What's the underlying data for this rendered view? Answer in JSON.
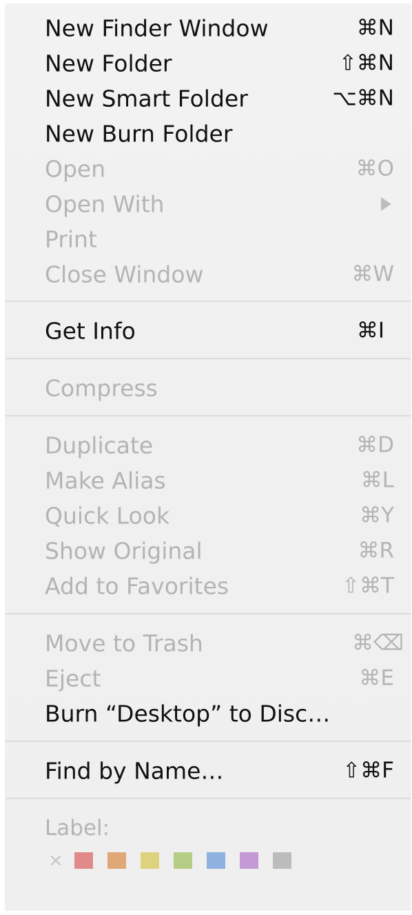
{
  "menu": {
    "items": [
      {
        "label": "New Finder Window",
        "shortcut": "⌘N"
      },
      {
        "label": "New Folder",
        "shortcut": "⇧⌘N"
      },
      {
        "label": "New Smart Folder",
        "shortcut": "⌥⌘N"
      },
      {
        "label": "New Burn Folder",
        "shortcut": ""
      },
      {
        "label": "Open",
        "shortcut": "⌘O"
      },
      {
        "label": "Open With",
        "shortcut": ""
      },
      {
        "label": "Print",
        "shortcut": ""
      },
      {
        "label": "Close Window",
        "shortcut": "⌘W"
      },
      {
        "label": "Get Info",
        "shortcut": "⌘I"
      },
      {
        "label": "Compress",
        "shortcut": ""
      },
      {
        "label": "Duplicate",
        "shortcut": "⌘D"
      },
      {
        "label": "Make Alias",
        "shortcut": "⌘L"
      },
      {
        "label": "Quick Look",
        "shortcut": "⌘Y"
      },
      {
        "label": "Show Original",
        "shortcut": "⌘R"
      },
      {
        "label": "Add to Favorites",
        "shortcut": "⇧⌘T"
      },
      {
        "label": "Move to Trash",
        "shortcut": "⌘⌫"
      },
      {
        "label": "Eject",
        "shortcut": "⌘E"
      },
      {
        "label": "Burn “Desktop” to Disc…",
        "shortcut": ""
      },
      {
        "label": "Find by Name…",
        "shortcut": "⇧⌘F"
      }
    ],
    "label_section": {
      "title": "Label:",
      "none_glyph": "×",
      "colors": [
        "#e08a8a",
        "#e0a777",
        "#ddd27e",
        "#b5cd84",
        "#8eb1df",
        "#c49ad6",
        "#bcbcbc"
      ]
    }
  }
}
